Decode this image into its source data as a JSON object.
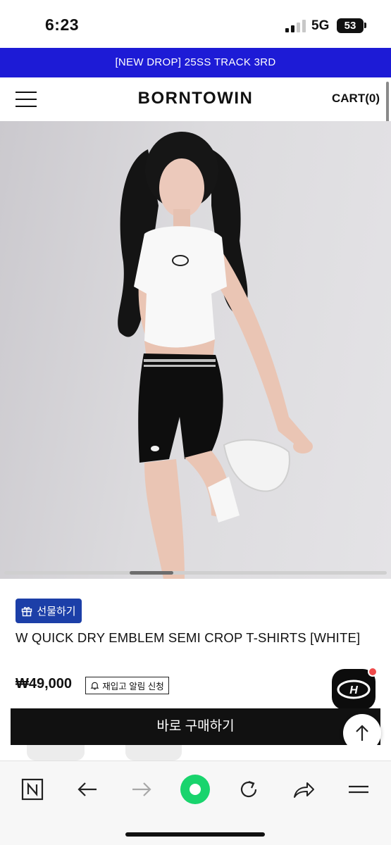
{
  "status_bar": {
    "time": "6:23",
    "network": "5G",
    "battery": "53"
  },
  "announcement": {
    "text": "[NEW DROP] 25SS TRACK 3RD"
  },
  "header": {
    "brand": "BORNTOWIN",
    "cart_label": "CART(0)"
  },
  "hero": {
    "slide_position": 0.37
  },
  "product": {
    "gift_label": "선물하기",
    "title": "W QUICK DRY EMBLEM SEMI CROP T-SHIRTS [WHITE]",
    "price": "₩49,000",
    "restock_label": "재입고 알림 신청",
    "buy_label": "바로 구매하기"
  },
  "colors": {
    "announcement_bg": "#1d1bd6",
    "gift_button_bg": "#1c3fa8",
    "buy_button_bg": "#111111",
    "browser_home_accent": "#19d46d",
    "notification_badge": "#ef4b4b"
  },
  "icons": {
    "menu": "menu-icon",
    "gift": "gift-icon",
    "bell": "bell-icon",
    "back": "arrow-left-icon",
    "forward": "arrow-right-icon",
    "reload": "reload-icon",
    "share": "share-icon",
    "more": "menu-lines-icon",
    "browser_logo": "n-logo-icon",
    "scroll_top": "arrow-up-icon"
  }
}
